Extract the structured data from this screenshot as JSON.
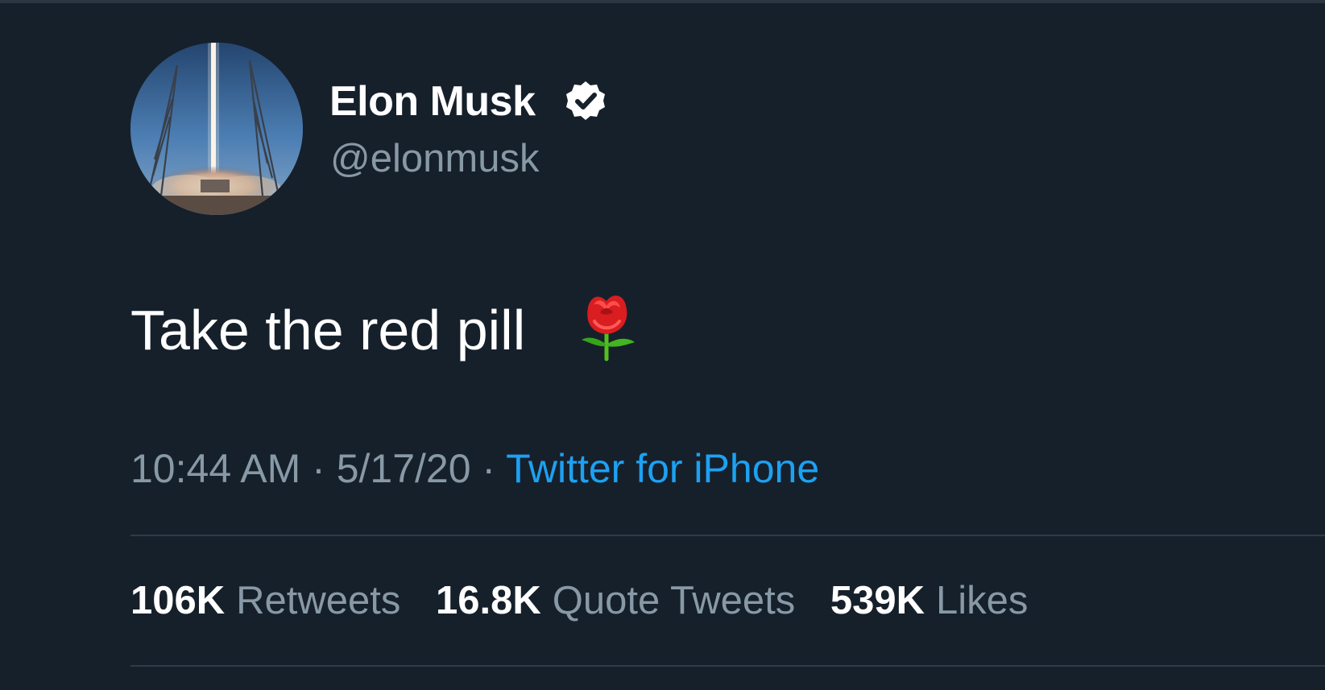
{
  "author": {
    "display_name": "Elon Musk",
    "handle": "@elonmusk",
    "verified": true,
    "avatar_icon": "rocket-launch-avatar",
    "verified_icon": "verified-badge-icon"
  },
  "tweet": {
    "text": "Take the red pill",
    "emoji_icon": "rose-icon"
  },
  "meta": {
    "time": "10:44 AM",
    "separator": " · ",
    "date": "5/17/20",
    "source": "Twitter for iPhone"
  },
  "stats": [
    {
      "count": "106K",
      "label": "Retweets"
    },
    {
      "count": "16.8K",
      "label": "Quote Tweets"
    },
    {
      "count": "539K",
      "label": "Likes"
    }
  ],
  "colors": {
    "background": "#16202b",
    "primary_text": "#ffffff",
    "secondary_text": "#8899a6",
    "accent": "#1da1f2",
    "divider": "#2f3c48"
  }
}
